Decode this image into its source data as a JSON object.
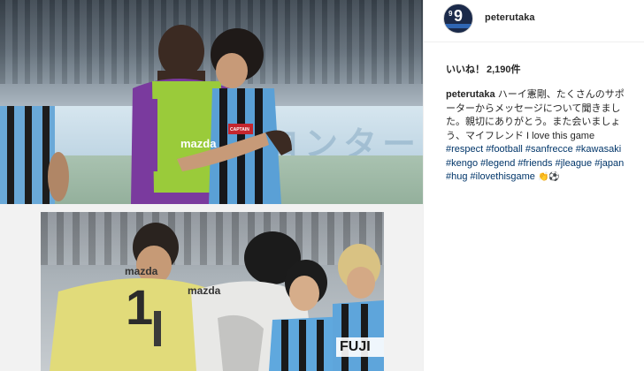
{
  "post": {
    "username": "peterutaka",
    "avatar": {
      "small_number": "9",
      "big_number": "9",
      "brand_color": "#1b2a4a"
    },
    "likes": {
      "label": "いいね！",
      "count": "2,190件"
    },
    "caption": {
      "user": "peterutaka",
      "text": "ハーイ憲剛、たくさんのサポーターからメッセージについて聞きました。親切にありがとう。また会いましょう、マイフレンド I love this game",
      "hashtags": [
        "#respect",
        "#football",
        "#sanfrecce",
        "#kawasaki",
        "#kengo",
        "#legend",
        "#friends",
        "#jleague",
        "#japan",
        "#hug",
        "#ilovethisgame"
      ],
      "emoji": "👏⚽"
    },
    "photo_top": {
      "sponsor": "mazda",
      "armband": "CAPTAIN",
      "board_text": "ロンターレ"
    },
    "photo_bottom": {
      "jersey_number": "1",
      "sponsor_left": "mazda",
      "sponsor_mid": "mazda",
      "sponsor_right": "FUJI"
    }
  },
  "colors": {
    "link": "#003569",
    "text": "#262626",
    "border": "#efefef"
  }
}
